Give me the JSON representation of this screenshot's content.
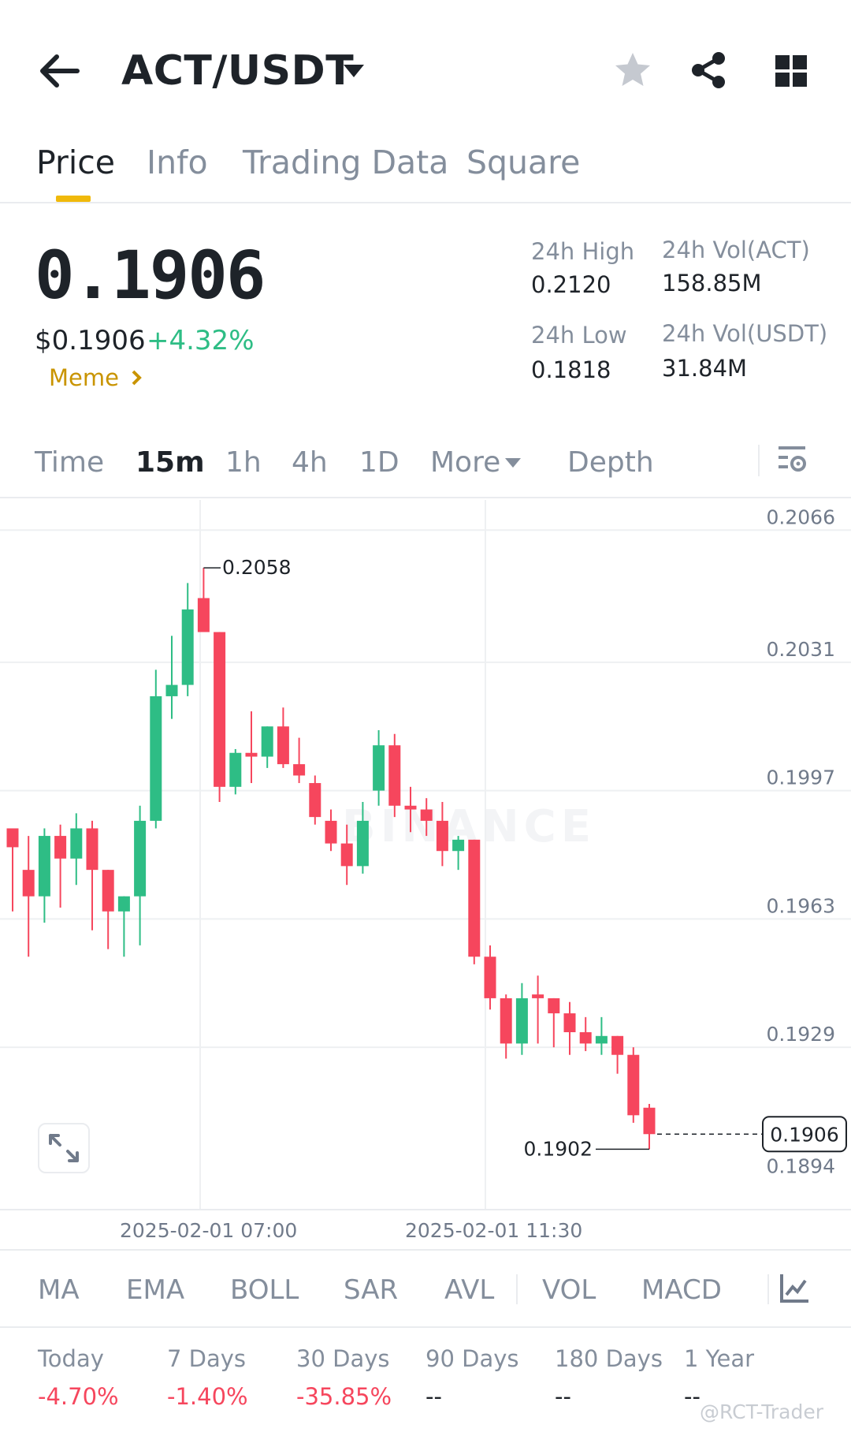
{
  "header": {
    "pair": "ACT/USDT",
    "icons": [
      "arrow-left-icon",
      "caret-down-icon",
      "star-icon",
      "share-icon",
      "grid-icon"
    ]
  },
  "tabs": [
    {
      "label": "Price",
      "active": true
    },
    {
      "label": "Info",
      "active": false
    },
    {
      "label": "Trading Data",
      "active": false
    },
    {
      "label": "Square",
      "active": false
    }
  ],
  "price": {
    "last": "0.1906",
    "usd": "$0.1906",
    "change_pct": "+4.32%",
    "tag": "Meme"
  },
  "stats": {
    "high_label": "24h High",
    "high_value": "0.2120",
    "low_label": "24h Low",
    "low_value": "0.1818",
    "vol_base_label": "24h Vol(ACT)",
    "vol_base_value": "158.85M",
    "vol_quote_label": "24h Vol(USDT)",
    "vol_quote_value": "31.84M"
  },
  "intervals": {
    "items": [
      "Time",
      "15m",
      "1h",
      "4h",
      "1D",
      "More",
      "Depth"
    ],
    "active": "15m"
  },
  "chart_data": {
    "type": "candlestick",
    "ylim": [
      0.1886,
      0.2074
    ],
    "y_ticks": [
      "0.2066",
      "0.2031",
      "0.1997",
      "0.1963",
      "0.1929",
      "0.1894"
    ],
    "x_ticks": [
      "2025-02-01 07:00",
      "2025-02-01 11:30"
    ],
    "high_marker": "0.2058",
    "low_marker": "0.1902",
    "last_price": "0.1906",
    "watermark": "BINANCE",
    "candles": [
      {
        "o": 0.1987,
        "h": 0.1987,
        "l": 0.1965,
        "c": 0.1982
      },
      {
        "o": 0.1976,
        "h": 0.1985,
        "l": 0.1953,
        "c": 0.1969
      },
      {
        "o": 0.1969,
        "h": 0.1987,
        "l": 0.1962,
        "c": 0.1985
      },
      {
        "o": 0.1985,
        "h": 0.1988,
        "l": 0.1966,
        "c": 0.1979
      },
      {
        "o": 0.1979,
        "h": 0.1991,
        "l": 0.1972,
        "c": 0.1987
      },
      {
        "o": 0.1987,
        "h": 0.1989,
        "l": 0.196,
        "c": 0.1976
      },
      {
        "o": 0.1976,
        "h": 0.1976,
        "l": 0.1955,
        "c": 0.1965
      },
      {
        "o": 0.1965,
        "h": 0.1967,
        "l": 0.1953,
        "c": 0.1969
      },
      {
        "o": 0.1969,
        "h": 0.1993,
        "l": 0.1956,
        "c": 0.1989
      },
      {
        "o": 0.1989,
        "h": 0.2029,
        "l": 0.1987,
        "c": 0.2022
      },
      {
        "o": 0.2022,
        "h": 0.2038,
        "l": 0.2016,
        "c": 0.2025
      },
      {
        "o": 0.2025,
        "h": 0.2052,
        "l": 0.2022,
        "c": 0.2045
      },
      {
        "o": 0.2048,
        "h": 0.2056,
        "l": 0.2045,
        "c": 0.2039
      },
      {
        "o": 0.2039,
        "h": 0.2039,
        "l": 0.1994,
        "c": 0.1998
      },
      {
        "o": 0.1998,
        "h": 0.2008,
        "l": 0.1996,
        "c": 0.2007
      },
      {
        "o": 0.2007,
        "h": 0.2018,
        "l": 0.1999,
        "c": 0.2006
      },
      {
        "o": 0.2006,
        "h": 0.201,
        "l": 0.2003,
        "c": 0.2014
      },
      {
        "o": 0.2014,
        "h": 0.2019,
        "l": 0.2003,
        "c": 0.2004
      },
      {
        "o": 0.2004,
        "h": 0.2011,
        "l": 0.1999,
        "c": 0.2001
      },
      {
        "o": 0.1999,
        "h": 0.2001,
        "l": 0.1988,
        "c": 0.199
      },
      {
        "o": 0.1989,
        "h": 0.1992,
        "l": 0.1981,
        "c": 0.1983
      },
      {
        "o": 0.1983,
        "h": 0.1988,
        "l": 0.1972,
        "c": 0.1977
      },
      {
        "o": 0.1977,
        "h": 0.1994,
        "l": 0.1975,
        "c": 0.1989
      },
      {
        "o": 0.1997,
        "h": 0.2013,
        "l": 0.1993,
        "c": 0.2009
      },
      {
        "o": 0.2009,
        "h": 0.2012,
        "l": 0.199,
        "c": 0.1993
      },
      {
        "o": 0.1993,
        "h": 0.1998,
        "l": 0.1986,
        "c": 0.1992
      },
      {
        "o": 0.1992,
        "h": 0.1995,
        "l": 0.1985,
        "c": 0.1989
      },
      {
        "o": 0.1989,
        "h": 0.1994,
        "l": 0.1977,
        "c": 0.1981
      },
      {
        "o": 0.1981,
        "h": 0.1985,
        "l": 0.1976,
        "c": 0.1984
      },
      {
        "o": 0.1984,
        "h": 0.1984,
        "l": 0.1951,
        "c": 0.1953
      },
      {
        "o": 0.1953,
        "h": 0.1956,
        "l": 0.1939,
        "c": 0.1942
      },
      {
        "o": 0.1942,
        "h": 0.1943,
        "l": 0.1926,
        "c": 0.193
      },
      {
        "o": 0.193,
        "h": 0.1946,
        "l": 0.1927,
        "c": 0.1942
      },
      {
        "o": 0.1943,
        "h": 0.1948,
        "l": 0.193,
        "c": 0.1942
      },
      {
        "o": 0.1942,
        "h": 0.1941,
        "l": 0.1929,
        "c": 0.1938
      },
      {
        "o": 0.1938,
        "h": 0.1941,
        "l": 0.1927,
        "c": 0.1933
      },
      {
        "o": 0.1933,
        "h": 0.1937,
        "l": 0.1928,
        "c": 0.193
      },
      {
        "o": 0.193,
        "h": 0.1937,
        "l": 0.1927,
        "c": 0.1932
      },
      {
        "o": 0.1932,
        "h": 0.1932,
        "l": 0.1922,
        "c": 0.1927
      },
      {
        "o": 0.1927,
        "h": 0.1929,
        "l": 0.1909,
        "c": 0.1911
      },
      {
        "o": 0.1913,
        "h": 0.1914,
        "l": 0.1902,
        "c": 0.1906
      }
    ]
  },
  "indicators": [
    "MA",
    "EMA",
    "BOLL",
    "SAR",
    "AVL",
    "VOL",
    "MACD"
  ],
  "performance": [
    {
      "label": "Today",
      "value": "-4.70%"
    },
    {
      "label": "7 Days",
      "value": "-1.40%"
    },
    {
      "label": "30 Days",
      "value": "-35.85%"
    },
    {
      "label": "90 Days",
      "value": "--"
    },
    {
      "label": "180 Days",
      "value": "--"
    },
    {
      "label": "1 Year",
      "value": "--"
    }
  ],
  "watermark_text": "@RCT-Trader",
  "colors": {
    "up": "#2ebd85",
    "down": "#f6465d",
    "accent": "#f0b90b",
    "tag": "#c99400"
  }
}
